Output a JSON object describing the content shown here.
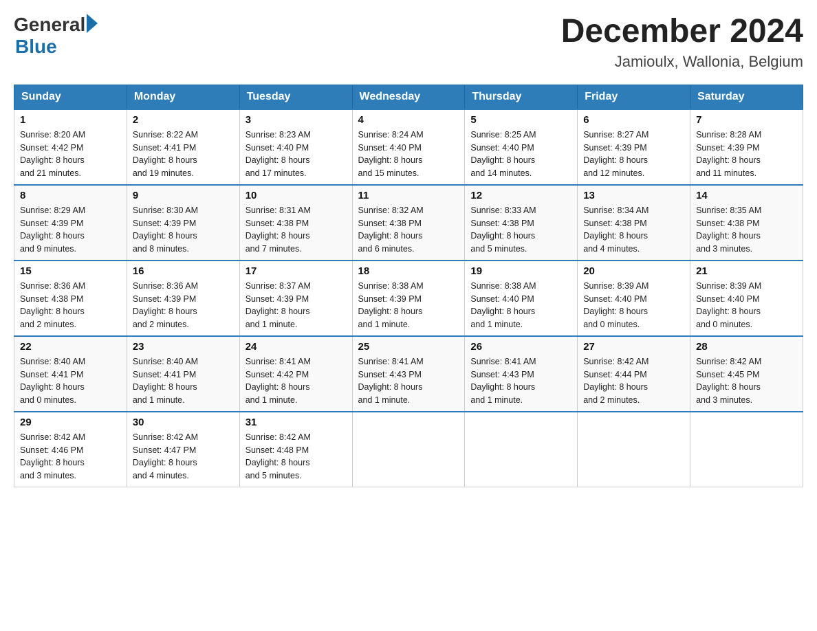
{
  "header": {
    "logo": {
      "text_general": "General",
      "text_blue": "Blue"
    },
    "title": "December 2024",
    "subtitle": "Jamioulx, Wallonia, Belgium"
  },
  "calendar": {
    "headers": [
      "Sunday",
      "Monday",
      "Tuesday",
      "Wednesday",
      "Thursday",
      "Friday",
      "Saturday"
    ],
    "weeks": [
      [
        {
          "day": "1",
          "sunrise": "8:20 AM",
          "sunset": "4:42 PM",
          "daylight": "8 hours and 21 minutes."
        },
        {
          "day": "2",
          "sunrise": "8:22 AM",
          "sunset": "4:41 PM",
          "daylight": "8 hours and 19 minutes."
        },
        {
          "day": "3",
          "sunrise": "8:23 AM",
          "sunset": "4:40 PM",
          "daylight": "8 hours and 17 minutes."
        },
        {
          "day": "4",
          "sunrise": "8:24 AM",
          "sunset": "4:40 PM",
          "daylight": "8 hours and 15 minutes."
        },
        {
          "day": "5",
          "sunrise": "8:25 AM",
          "sunset": "4:40 PM",
          "daylight": "8 hours and 14 minutes."
        },
        {
          "day": "6",
          "sunrise": "8:27 AM",
          "sunset": "4:39 PM",
          "daylight": "8 hours and 12 minutes."
        },
        {
          "day": "7",
          "sunrise": "8:28 AM",
          "sunset": "4:39 PM",
          "daylight": "8 hours and 11 minutes."
        }
      ],
      [
        {
          "day": "8",
          "sunrise": "8:29 AM",
          "sunset": "4:39 PM",
          "daylight": "8 hours and 9 minutes."
        },
        {
          "day": "9",
          "sunrise": "8:30 AM",
          "sunset": "4:39 PM",
          "daylight": "8 hours and 8 minutes."
        },
        {
          "day": "10",
          "sunrise": "8:31 AM",
          "sunset": "4:38 PM",
          "daylight": "8 hours and 7 minutes."
        },
        {
          "day": "11",
          "sunrise": "8:32 AM",
          "sunset": "4:38 PM",
          "daylight": "8 hours and 6 minutes."
        },
        {
          "day": "12",
          "sunrise": "8:33 AM",
          "sunset": "4:38 PM",
          "daylight": "8 hours and 5 minutes."
        },
        {
          "day": "13",
          "sunrise": "8:34 AM",
          "sunset": "4:38 PM",
          "daylight": "8 hours and 4 minutes."
        },
        {
          "day": "14",
          "sunrise": "8:35 AM",
          "sunset": "4:38 PM",
          "daylight": "8 hours and 3 minutes."
        }
      ],
      [
        {
          "day": "15",
          "sunrise": "8:36 AM",
          "sunset": "4:38 PM",
          "daylight": "8 hours and 2 minutes."
        },
        {
          "day": "16",
          "sunrise": "8:36 AM",
          "sunset": "4:39 PM",
          "daylight": "8 hours and 2 minutes."
        },
        {
          "day": "17",
          "sunrise": "8:37 AM",
          "sunset": "4:39 PM",
          "daylight": "8 hours and 1 minute."
        },
        {
          "day": "18",
          "sunrise": "8:38 AM",
          "sunset": "4:39 PM",
          "daylight": "8 hours and 1 minute."
        },
        {
          "day": "19",
          "sunrise": "8:38 AM",
          "sunset": "4:40 PM",
          "daylight": "8 hours and 1 minute."
        },
        {
          "day": "20",
          "sunrise": "8:39 AM",
          "sunset": "4:40 PM",
          "daylight": "8 hours and 0 minutes."
        },
        {
          "day": "21",
          "sunrise": "8:39 AM",
          "sunset": "4:40 PM",
          "daylight": "8 hours and 0 minutes."
        }
      ],
      [
        {
          "day": "22",
          "sunrise": "8:40 AM",
          "sunset": "4:41 PM",
          "daylight": "8 hours and 0 minutes."
        },
        {
          "day": "23",
          "sunrise": "8:40 AM",
          "sunset": "4:41 PM",
          "daylight": "8 hours and 1 minute."
        },
        {
          "day": "24",
          "sunrise": "8:41 AM",
          "sunset": "4:42 PM",
          "daylight": "8 hours and 1 minute."
        },
        {
          "day": "25",
          "sunrise": "8:41 AM",
          "sunset": "4:43 PM",
          "daylight": "8 hours and 1 minute."
        },
        {
          "day": "26",
          "sunrise": "8:41 AM",
          "sunset": "4:43 PM",
          "daylight": "8 hours and 1 minute."
        },
        {
          "day": "27",
          "sunrise": "8:42 AM",
          "sunset": "4:44 PM",
          "daylight": "8 hours and 2 minutes."
        },
        {
          "day": "28",
          "sunrise": "8:42 AM",
          "sunset": "4:45 PM",
          "daylight": "8 hours and 3 minutes."
        }
      ],
      [
        {
          "day": "29",
          "sunrise": "8:42 AM",
          "sunset": "4:46 PM",
          "daylight": "8 hours and 3 minutes."
        },
        {
          "day": "30",
          "sunrise": "8:42 AM",
          "sunset": "4:47 PM",
          "daylight": "8 hours and 4 minutes."
        },
        {
          "day": "31",
          "sunrise": "8:42 AM",
          "sunset": "4:48 PM",
          "daylight": "8 hours and 5 minutes."
        },
        null,
        null,
        null,
        null
      ]
    ],
    "labels": {
      "sunrise": "Sunrise:",
      "sunset": "Sunset:",
      "daylight": "Daylight:"
    }
  }
}
